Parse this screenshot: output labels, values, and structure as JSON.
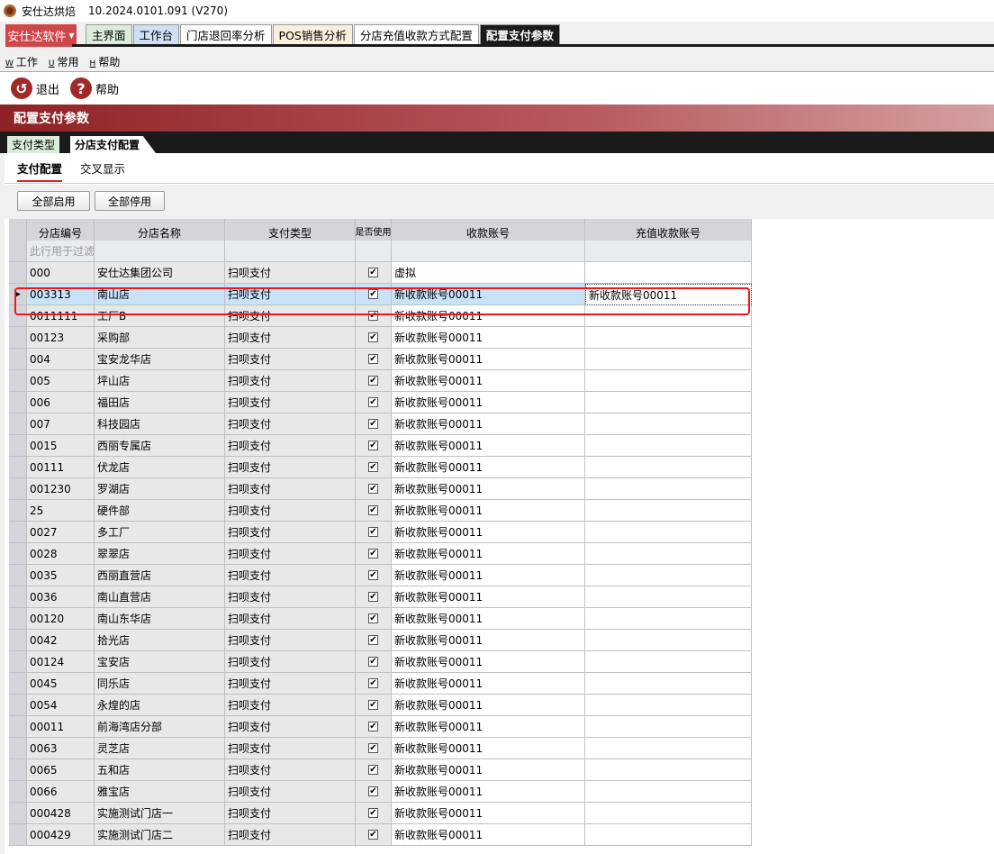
{
  "app": {
    "title": "安仕达烘焙",
    "version": "10.2024.0101.091 (V270)"
  },
  "brand_menu": "安仕达软件",
  "tabs": [
    {
      "label": "主界面",
      "bg": "#dcecdc"
    },
    {
      "label": "工作台",
      "bg": "#cfe0f5"
    },
    {
      "label": "门店退回率分析",
      "bg": "#ffffff"
    },
    {
      "label": "POS销售分析",
      "bg": "#fbf0dc"
    },
    {
      "label": "分店充值收款方式配置",
      "bg": "#ffffff"
    },
    {
      "label": "配置支付参数",
      "bg": "#1a1a1a",
      "active": true
    }
  ],
  "menu": [
    {
      "key": "W",
      "label": "工作"
    },
    {
      "key": "U",
      "label": "常用"
    },
    {
      "key": "H",
      "label": "帮助"
    }
  ],
  "toolbar": {
    "exit": "退出",
    "help": "帮助"
  },
  "page_title": "配置支付参数",
  "subtabs": [
    "支付类型",
    "分店支付配置"
  ],
  "inner_tabs": [
    "支付配置",
    "交叉显示"
  ],
  "buttons": {
    "enable_all": "全部启用",
    "disable_all": "全部停用"
  },
  "grid": {
    "columns": [
      "分店编号",
      "分店名称",
      "支付类型",
      "是否使用",
      "收款账号",
      "充值收款账号"
    ],
    "filter_hint": "此行用于过滤",
    "rows": [
      [
        "000",
        "安仕达集团公司",
        "扫呗支付",
        true,
        "虚拟",
        ""
      ],
      [
        "003313",
        "南山店",
        "扫呗支付",
        true,
        "新收款账号00011",
        "新收款账号00011"
      ],
      [
        "0011111",
        "工厂B",
        "扫呗支付",
        true,
        "新收款账号00011",
        ""
      ],
      [
        "00123",
        "采购部",
        "扫呗支付",
        true,
        "新收款账号00011",
        ""
      ],
      [
        "004",
        "宝安龙华店",
        "扫呗支付",
        true,
        "新收款账号00011",
        ""
      ],
      [
        "005",
        "坪山店",
        "扫呗支付",
        true,
        "新收款账号00011",
        ""
      ],
      [
        "006",
        "福田店",
        "扫呗支付",
        true,
        "新收款账号00011",
        ""
      ],
      [
        "007",
        "科技园店",
        "扫呗支付",
        true,
        "新收款账号00011",
        ""
      ],
      [
        "0015",
        "西丽专属店",
        "扫呗支付",
        true,
        "新收款账号00011",
        ""
      ],
      [
        "00111",
        "伏龙店",
        "扫呗支付",
        true,
        "新收款账号00011",
        ""
      ],
      [
        "001230",
        "罗湖店",
        "扫呗支付",
        true,
        "新收款账号00011",
        ""
      ],
      [
        "25",
        "硬件部",
        "扫呗支付",
        true,
        "新收款账号00011",
        ""
      ],
      [
        "0027",
        "多工厂",
        "扫呗支付",
        true,
        "新收款账号00011",
        ""
      ],
      [
        "0028",
        "翠翠店",
        "扫呗支付",
        true,
        "新收款账号00011",
        ""
      ],
      [
        "0035",
        "西丽直营店",
        "扫呗支付",
        true,
        "新收款账号00011",
        ""
      ],
      [
        "0036",
        "南山直营店",
        "扫呗支付",
        true,
        "新收款账号00011",
        ""
      ],
      [
        "00120",
        "南山东华店",
        "扫呗支付",
        true,
        "新收款账号00011",
        ""
      ],
      [
        "0042",
        "拾光店",
        "扫呗支付",
        true,
        "新收款账号00011",
        ""
      ],
      [
        "00124",
        "宝安店",
        "扫呗支付",
        true,
        "新收款账号00011",
        ""
      ],
      [
        "0045",
        "同乐店",
        "扫呗支付",
        true,
        "新收款账号00011",
        ""
      ],
      [
        "0054",
        "永煌的店",
        "扫呗支付",
        true,
        "新收款账号00011",
        ""
      ],
      [
        "00011",
        "前海湾店分部",
        "扫呗支付",
        true,
        "新收款账号00011",
        ""
      ],
      [
        "0063",
        "灵芝店",
        "扫呗支付",
        true,
        "新收款账号00011",
        ""
      ],
      [
        "0065",
        "五和店",
        "扫呗支付",
        true,
        "新收款账号00011",
        ""
      ],
      [
        "0066",
        "雅宝店",
        "扫呗支付",
        true,
        "新收款账号00011",
        ""
      ],
      [
        "000428",
        "实施测试门店一",
        "扫呗支付",
        true,
        "新收款账号00011",
        ""
      ],
      [
        "000429",
        "实施测试门店二",
        "扫呗支付",
        true,
        "新收款账号00011",
        ""
      ]
    ],
    "selected_index": 1
  }
}
